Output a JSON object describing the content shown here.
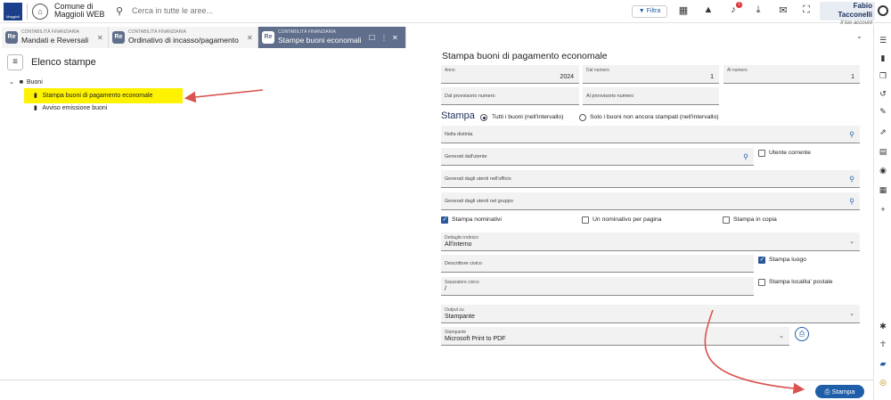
{
  "header": {
    "logo_text": "Maggioli",
    "app_name_line1": "Comune di",
    "app_name_line2": "Maggioli WEB",
    "search_placeholder": "Cerca in tutte le aree...",
    "filter_label": "Filtra",
    "notification_count": "1",
    "user_name": "Fabio Tacconelli",
    "user_sub": "Il tuo account"
  },
  "tabs": [
    {
      "section": "CONTABILITÀ FINANZIARIA",
      "title": "Mandati e Reversali",
      "badge": "Re",
      "active": false
    },
    {
      "section": "CONTABILITÀ FINANZIARIA",
      "title": "Ordinativo di incasso/pagamento",
      "badge": "Re",
      "active": false
    },
    {
      "section": "CONTABILITÀ FINANZIARIA",
      "title": "Stampe buoni economali",
      "badge": "Re",
      "active": true
    }
  ],
  "left_panel": {
    "title": "Elenco stampe",
    "tree": {
      "folder": "Buoni",
      "items": [
        {
          "label": "Stampa buoni di pagamento economale",
          "selected": true
        },
        {
          "label": "Avviso emissione buoni",
          "selected": false
        }
      ]
    }
  },
  "form": {
    "title": "Stampa buoni di pagamento economale",
    "anno": {
      "label": "Anno",
      "value": "2024"
    },
    "dal_numero": {
      "label": "Dal numero",
      "value": "1"
    },
    "al_numero": {
      "label": "Al numero",
      "value": "1"
    },
    "dal_provvisorio": {
      "label": "Dal provvisorio numero"
    },
    "al_provvisorio": {
      "label": "Al provvisorio numero"
    },
    "stampa_heading": "Stampa",
    "radio_tutti": "Tutti i buoni (nell'intervallo)",
    "radio_solo": "Solo i buoni non ancora stampati (nell'intervallo)",
    "nella_distinta": "Nella distinta",
    "generati_utente": "Generati dall'utente",
    "utente_corrente": "Utente corrente",
    "generati_ufficio": "Generati dagli utenti nell'ufficio",
    "generati_gruppo": "Generati dagli utenti nel gruppo",
    "stampa_nominativi": "Stampa nominativi",
    "un_nominativo": "Un nominativo per pagina",
    "stampa_copia": "Stampa in copia",
    "dettaglio": {
      "label": "Dettaglio indirizzi",
      "value": "All'interno"
    },
    "descrittore": "Descrittore civico",
    "stampa_luogo": "Stampa luogo",
    "separatore": {
      "label": "Separatore civico",
      "value": "/"
    },
    "stampa_localita": "Stampa localita' postale",
    "output": {
      "label": "Output su",
      "value": "Stampante"
    },
    "stampante": {
      "label": "Stampante",
      "value": "Microsoft Print to PDF"
    },
    "checks": {
      "stampa_nominativi": true,
      "un_nominativo": false,
      "stampa_copia": false,
      "utente_corrente": false,
      "stampa_luogo": true,
      "stampa_localita": false
    }
  },
  "footer": {
    "stampa_button": "Stampa"
  },
  "icons": {
    "search": "search-icon",
    "filter": "filter-icon",
    "print": "printer-icon"
  },
  "colors": {
    "primary": "#1f5faa",
    "tab_active": "#5f6e8a",
    "highlight": "#fff200",
    "annotation_arrow": "#d9534f"
  }
}
